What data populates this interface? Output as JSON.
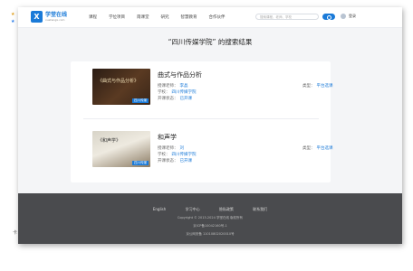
{
  "side": {
    "marks": [
      "★",
      "★"
    ],
    "bottom": "卡"
  },
  "header": {
    "logo_name": "学堂在线",
    "logo_sub": "xuetangx.com",
    "nav": [
      "课程",
      "学位项目",
      "雨课堂",
      "研究",
      "智慧教育",
      "合作伙伴"
    ],
    "search_placeholder": "搜索课程、老师、学校",
    "user_name": "登录"
  },
  "result_title": "“四川传媒学院” 的搜索结果",
  "results": [
    {
      "course": "曲式与作品分析",
      "thumb_title": "《曲式与作品分析》",
      "thumb_badge": "四川传媒",
      "teacher_label": "授课老师：",
      "teacher": "李晶",
      "school_label": "学校：",
      "school": "四川传媒学院",
      "status_label": "开课状态：",
      "status": "已开课",
      "type_label": "类型：",
      "type": "平台选课"
    },
    {
      "course": "和声学",
      "thumb_title": "《和声学》",
      "thumb_badge": "四川传媒",
      "teacher_label": "授课老师：",
      "teacher": "刘",
      "school_label": "学校：",
      "school": "四川传媒学院",
      "status_label": "开课状态：",
      "status": "已开课",
      "type_label": "类型：",
      "type": "平台选课"
    }
  ],
  "footer": {
    "links": [
      "English",
      "学习中心",
      "隐私政策",
      "联系我们"
    ],
    "copyright": "Copyright © 2013-2024 学堂在线 版权所有",
    "icp": "京ICP备10042160号-1",
    "license": "京公网安备 11010802020010号"
  }
}
